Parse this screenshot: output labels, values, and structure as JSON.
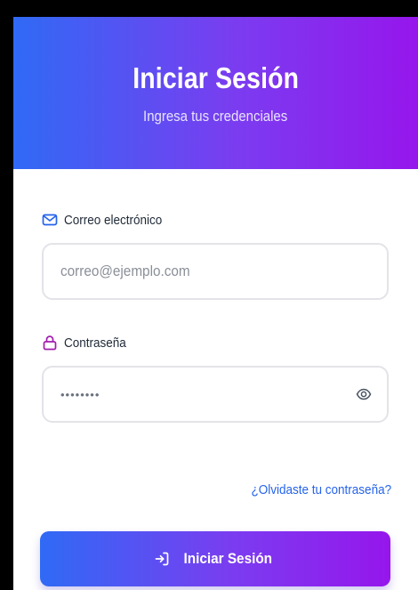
{
  "header": {
    "title": "Iniciar Sesión",
    "subtitle": "Ingresa tus credenciales"
  },
  "email": {
    "label": "Correo electrónico",
    "icon": "mail-icon",
    "placeholder": "correo@ejemplo.com",
    "value": ""
  },
  "password": {
    "label": "Contraseña",
    "icon": "lock-icon",
    "masked_value": "••••••••",
    "toggle_icon": "eye-icon"
  },
  "forgot_link": "¿Olvidaste tu contraseña?",
  "submit": {
    "label": "Iniciar Sesión",
    "icon": "login-arrow-icon"
  },
  "colors": {
    "gradient_start": "#2f6af5",
    "gradient_end": "#9616ec",
    "email_icon": "#2563eb",
    "lock_icon": "#a21caf",
    "link": "#2563eb"
  }
}
